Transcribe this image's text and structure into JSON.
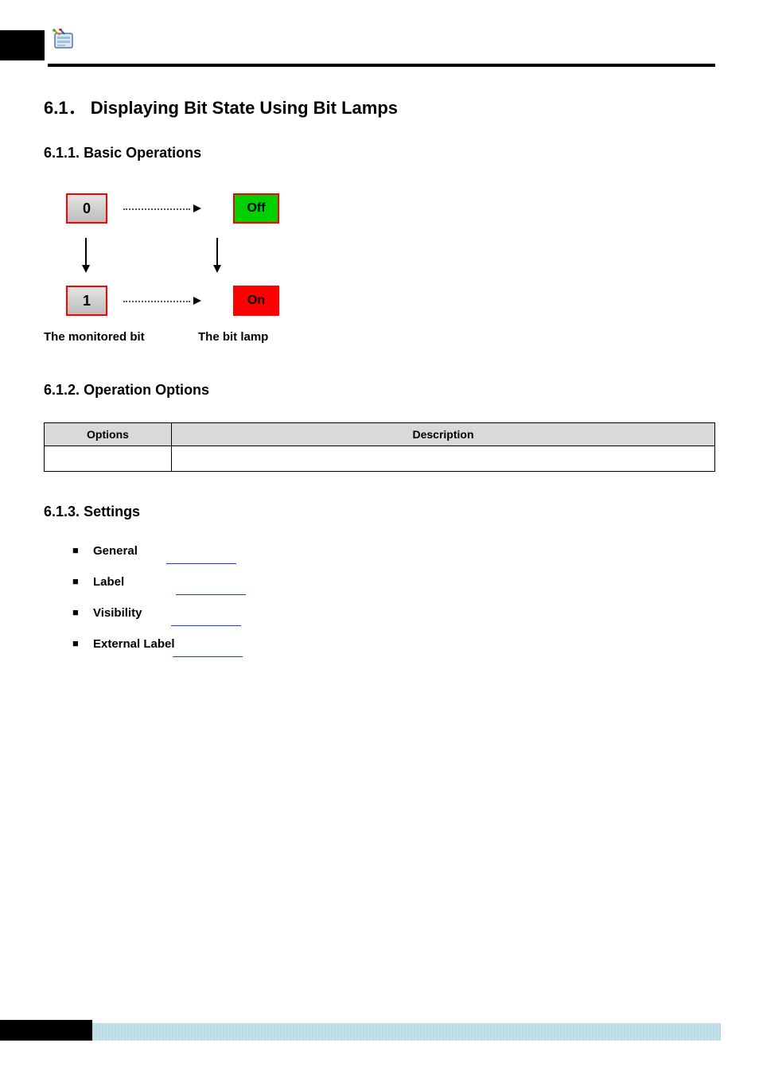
{
  "section": {
    "number": "6.1",
    "title": "Displaying Bit State Using Bit Lamps"
  },
  "sub1": {
    "number": "6.1.1.",
    "title": "Basic Operations"
  },
  "diagram": {
    "state_off": "0",
    "state_on": "1",
    "lamp_off": "Off",
    "lamp_on": "On",
    "caption_left": "The monitored bit",
    "caption_right": "The bit lamp"
  },
  "sub2": {
    "number": "6.1.2.",
    "title": "Operation Options"
  },
  "table": {
    "col1": "Options",
    "col2": "Description"
  },
  "sub3": {
    "number": "6.1.3.",
    "title": "Settings"
  },
  "settings": {
    "items": [
      {
        "label": "General"
      },
      {
        "label": "Label"
      },
      {
        "label": "Visibility"
      },
      {
        "label": "External Label"
      }
    ]
  }
}
